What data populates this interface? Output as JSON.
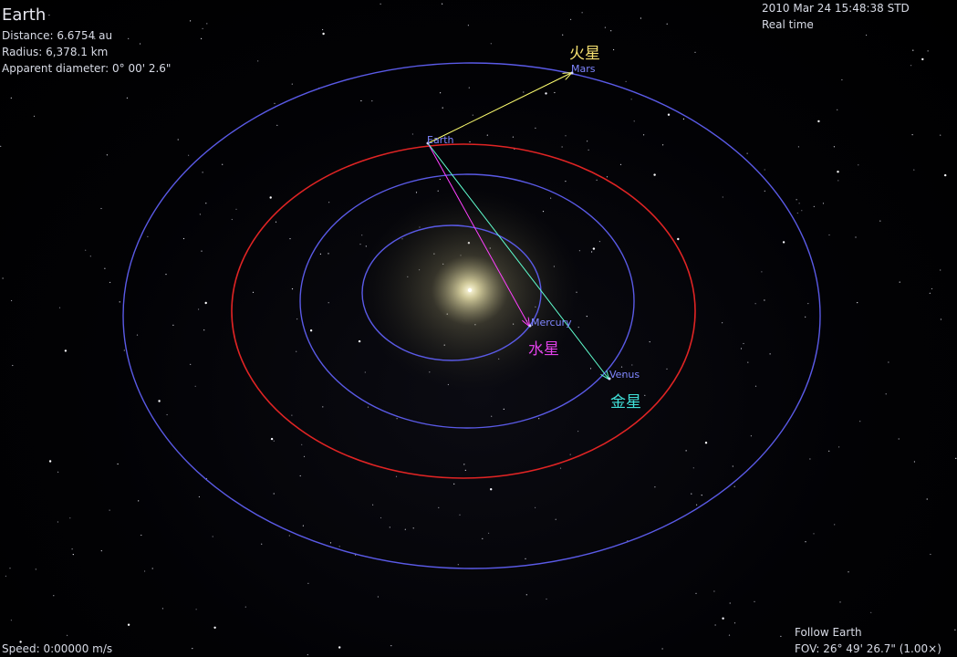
{
  "selected_object": {
    "name": "Earth",
    "distance": "Distance: 6.6754 au",
    "radius": "Radius: 6,378.1 km",
    "apparent_diameter": "Apparent diameter: 0° 00' 2.6\""
  },
  "time": {
    "datetime": "2010 Mar 24 15:48:38 STD",
    "mode": "Real time"
  },
  "status": {
    "speed": "Speed: 0:00000 m/s",
    "follow": "Follow Earth",
    "fov": "FOV: 26° 49' 26.7\" (1.00×)"
  },
  "bodies": {
    "earth": {
      "label": "Earth"
    },
    "mars": {
      "label": "Mars",
      "cjk": "火星"
    },
    "mercury": {
      "label": "Mercury",
      "cjk": "水星"
    },
    "venus": {
      "label": "Venus",
      "cjk": "金星"
    }
  },
  "colors": {
    "orbit": "#5a5ae6",
    "earth_orbit": "#e02424",
    "mars_vector": "#ffff70",
    "mercury_vector": "#ff40ff",
    "venus_vector": "#60ffd0",
    "mars_cjk": "#f5e070",
    "mercury_cjk": "#e040e8",
    "venus_cjk": "#40e0d8"
  }
}
